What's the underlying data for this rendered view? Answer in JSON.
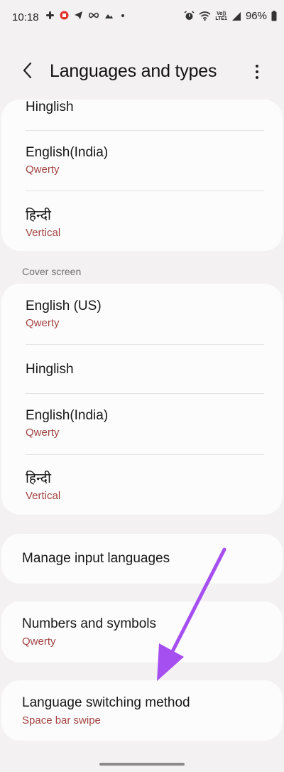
{
  "status_bar": {
    "time": "10:18",
    "lte_top": "Vo))",
    "lte_bottom": "LTE1",
    "battery": "96%"
  },
  "header": {
    "title": "Languages and types"
  },
  "main_list": {
    "items": [
      {
        "title": "Hinglish",
        "subtitle": ""
      },
      {
        "title": "English(India)",
        "subtitle": "Qwerty"
      },
      {
        "title": "हिन्दी",
        "subtitle": "Vertical"
      }
    ]
  },
  "cover_screen": {
    "header": "Cover screen",
    "items": [
      {
        "title": "English (US)",
        "subtitle": "Qwerty"
      },
      {
        "title": "Hinglish",
        "subtitle": ""
      },
      {
        "title": "English(India)",
        "subtitle": "Qwerty"
      },
      {
        "title": "हिन्दी",
        "subtitle": "Vertical"
      }
    ]
  },
  "settings": {
    "manage": {
      "title": "Manage input languages"
    },
    "numbers": {
      "title": "Numbers and symbols",
      "subtitle": "Qwerty"
    },
    "switching": {
      "title": "Language switching method",
      "subtitle": "Space bar swipe"
    }
  },
  "colors": {
    "accent_subtitle": "#a24442",
    "annotation_arrow": "#a64ff0",
    "card_bg": "#fcfcfc",
    "page_bg": "#f3f1f2"
  }
}
